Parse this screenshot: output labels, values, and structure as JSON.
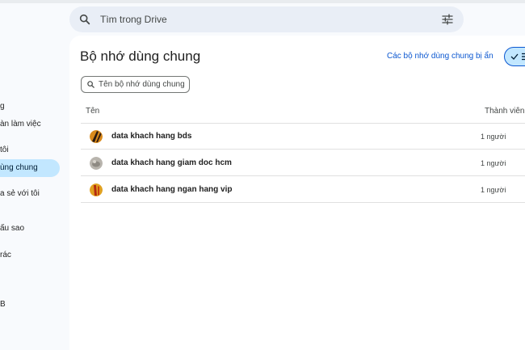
{
  "search": {
    "placeholder": "Tìm trong Drive"
  },
  "sidebar": {
    "items": [
      {
        "label": "g",
        "top": 0
      },
      {
        "label": "àn làm việc"
      },
      {
        "label": "tôi"
      },
      {
        "label": "ùng chung"
      },
      {
        "label": "a sẻ với tôi"
      },
      {
        "label": "ấu sao"
      },
      {
        "label": "rác"
      },
      {
        "label": "B"
      }
    ]
  },
  "main": {
    "title": "Bộ nhớ dùng chung",
    "hidden_link": "Các bộ nhớ dùng chung bị ẩn",
    "filter_placeholder": "Tên bộ nhớ dùng chung",
    "columns": {
      "name": "Tên",
      "members": "Thành viên"
    },
    "rows": [
      {
        "name": "data khach hang bds",
        "members": "1 người"
      },
      {
        "name": "data khach hang giam doc hcm",
        "members": "1 người"
      },
      {
        "name": "data khach hang ngan hang vip",
        "members": "1 người"
      }
    ]
  },
  "icons": {
    "search": "search-icon",
    "filter": "tune-icon",
    "check": "check-icon",
    "list": "list-view-icon"
  },
  "colors": {
    "accent": "#0b57d0",
    "active_bg": "#c2e7ff",
    "search_bg": "#e9eef6"
  }
}
